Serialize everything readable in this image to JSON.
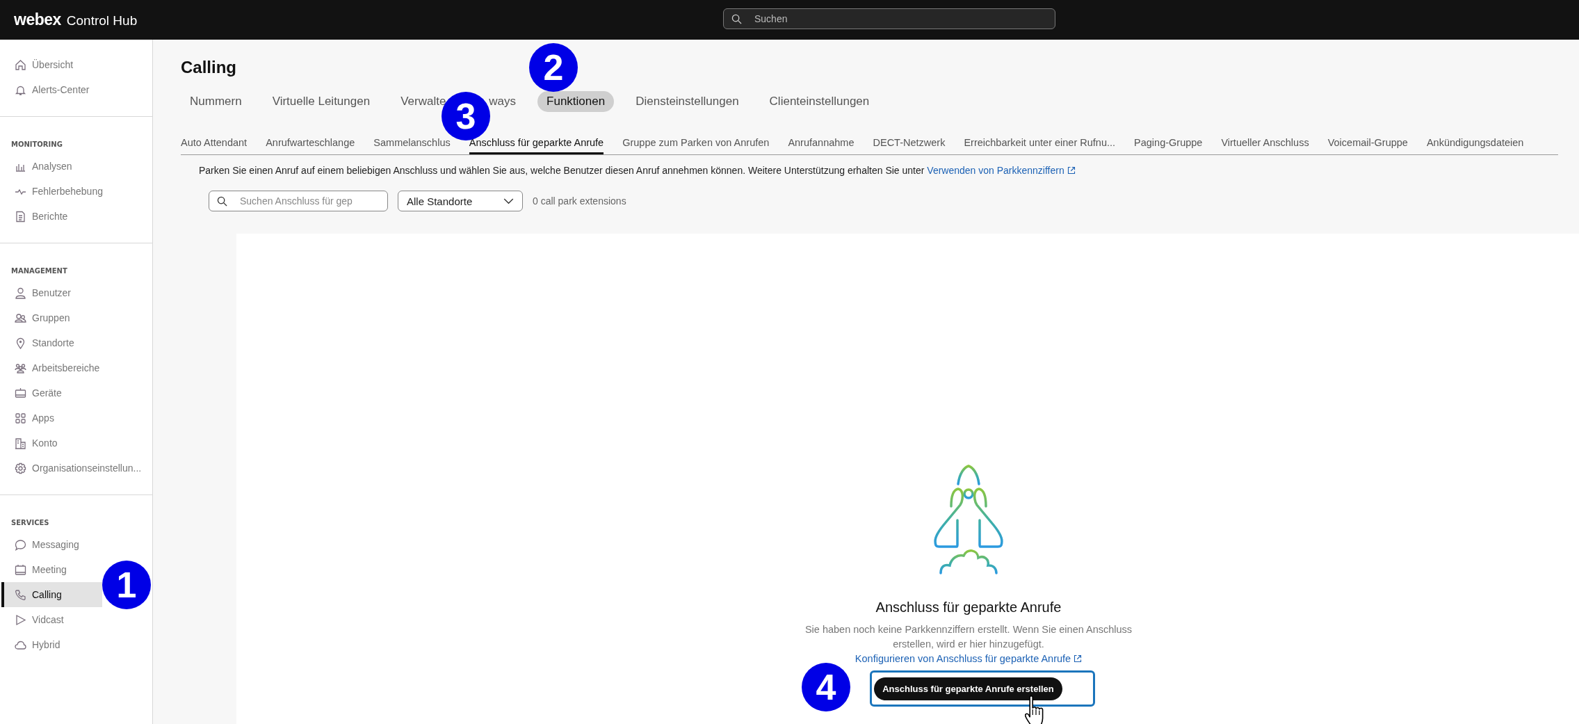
{
  "header": {
    "brand": "webex",
    "product": "Control Hub",
    "search": {
      "placeholder": "Suchen"
    }
  },
  "sidebar": {
    "sections": [
      {
        "items": [
          {
            "label": "Übersicht",
            "selected": false
          },
          {
            "label": "Alerts-Center",
            "selected": false
          }
        ]
      },
      {
        "heading": "MONITORING",
        "items": [
          {
            "label": "Analysen",
            "selected": false
          },
          {
            "label": "Fehlerbehebung",
            "selected": false
          },
          {
            "label": "Berichte",
            "selected": false
          }
        ]
      },
      {
        "heading": "MANAGEMENT",
        "items": [
          {
            "label": "Benutzer",
            "selected": false
          },
          {
            "label": "Gruppen",
            "selected": false
          },
          {
            "label": "Standorte",
            "selected": false
          },
          {
            "label": "Arbeitsbereiche",
            "selected": false
          },
          {
            "label": "Geräte",
            "selected": false
          },
          {
            "label": "Apps",
            "selected": false
          },
          {
            "label": "Konto",
            "selected": false
          },
          {
            "label": "Organisationseinstellun...",
            "selected": false
          }
        ]
      },
      {
        "heading": "SERVICES",
        "items": [
          {
            "label": "Messaging",
            "selected": false
          },
          {
            "label": "Meeting",
            "selected": false
          },
          {
            "label": "Calling",
            "selected": true
          },
          {
            "label": "Vidcast",
            "selected": false
          },
          {
            "label": "Hybrid",
            "selected": false
          }
        ]
      }
    ]
  },
  "page": {
    "title": "Calling",
    "tabs": [
      {
        "label": "Nummern",
        "selected": false
      },
      {
        "label": "Virtuelle Leitungen",
        "selected": false
      },
      {
        "label": "Verwalte",
        "label_tail": "ways",
        "selected": false
      },
      {
        "label": "Funktionen",
        "selected": true
      },
      {
        "label": "Diensteinstellungen",
        "selected": false
      },
      {
        "label": "Clienteinstellungen",
        "selected": false
      }
    ],
    "subtabs": [
      {
        "label": "Auto Attendant",
        "selected": false
      },
      {
        "label": "Anrufwarteschlange",
        "selected": false
      },
      {
        "label": "Sammelanschlus",
        "selected": false
      },
      {
        "label": "Anschluss für geparkte Anrufe",
        "selected": true
      },
      {
        "label": "Gruppe zum Parken von Anrufen",
        "selected": false
      },
      {
        "label": "Anrufannahme",
        "selected": false
      },
      {
        "label": "DECT-Netzwerk",
        "selected": false
      },
      {
        "label": "Erreichbarkeit unter einer Rufnu...",
        "selected": false
      },
      {
        "label": "Paging-Gruppe",
        "selected": false
      },
      {
        "label": "Virtueller Anschluss",
        "selected": false
      },
      {
        "label": "Voicemail-Gruppe",
        "selected": false
      },
      {
        "label": "Ankündigungsdateien",
        "selected": false
      }
    ],
    "description": {
      "text": "Parken Sie einen Anruf auf einem beliebigen Anschluss und wählen Sie aus, welche Benutzer diesen Anruf annehmen können. Weitere Unterstützung erhalten Sie unter ",
      "link": "Verwenden von Parkkennziffern"
    },
    "search": {
      "placeholder": "Suchen Anschluss für gep"
    },
    "location_filter": {
      "value": "Alle Standorte"
    },
    "count": "0 call park extensions",
    "empty_state": {
      "heading": "Anschluss für geparkte Anrufe",
      "text": "Sie haben noch keine Parkkennziffern erstellt. Wenn Sie einen Anschluss erstellen, wird er hier hinzugefügt. ",
      "link": "Konfigurieren von Anschluss für geparkte Anrufe",
      "button": "Anschluss für geparkte Anrufe erstellen"
    }
  },
  "annotations": [
    {
      "number": "1"
    },
    {
      "number": "2"
    },
    {
      "number": "3"
    },
    {
      "number": "4"
    }
  ]
}
